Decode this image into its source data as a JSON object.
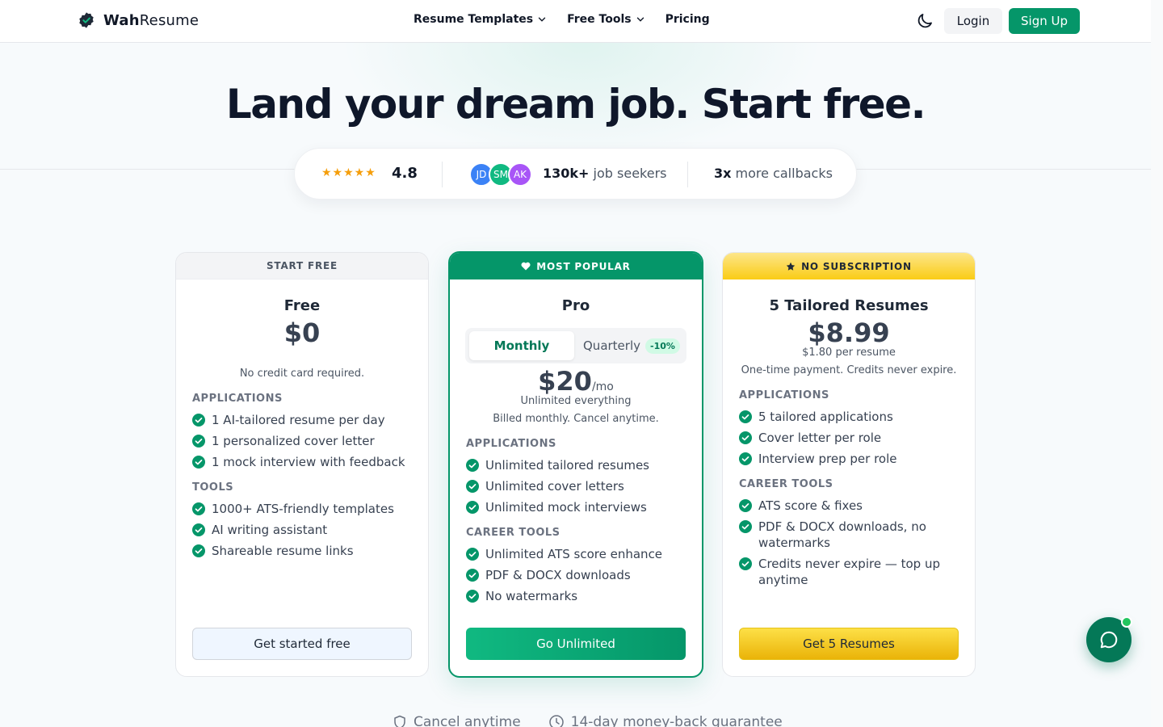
{
  "header": {
    "logo_bold": "Wah",
    "logo_rest": "Resume",
    "nav": [
      {
        "label": "Resume Templates",
        "dropdown": true
      },
      {
        "label": "Free Tools",
        "dropdown": true
      },
      {
        "label": "Pricing",
        "dropdown": false
      }
    ],
    "login_label": "Login",
    "signup_label": "Sign Up",
    "accent": "#059669"
  },
  "hero": {
    "title": "Land your dream job. Start free.",
    "stats": {
      "stars": "★★★★★",
      "rating": "4.8",
      "avatars": [
        {
          "initials": "JD",
          "color": "#3b82f6"
        },
        {
          "initials": "SM",
          "color": "#10b981"
        },
        {
          "initials": "AK",
          "color": "#a855f7"
        }
      ],
      "seekers_count": "130k+",
      "seekers_label": "job seekers",
      "callbacks_count": "3x",
      "callbacks_label": "more callbacks"
    }
  },
  "plans": {
    "free": {
      "ribbon": "START FREE",
      "name": "Free",
      "price": "$0",
      "note": "No credit card required.",
      "section1": "APPLICATIONS",
      "features1": [
        "1 AI-tailored resume per day",
        "1 personalized cover letter",
        "1 mock interview with feedback"
      ],
      "section2": "TOOLS",
      "features2": [
        "1000+ ATS-friendly templates",
        "AI writing assistant",
        "Shareable resume links"
      ],
      "cta": "Get started free"
    },
    "pro": {
      "ribbon": "MOST POPULAR",
      "name": "Pro",
      "billing_monthly": "Monthly",
      "billing_quarterly": "Quarterly",
      "discount": "-10%",
      "price": "$20",
      "per": "/mo",
      "subtitle": "Unlimited everything",
      "note": "Billed monthly. Cancel anytime.",
      "section1": "APPLICATIONS",
      "features1": [
        "Unlimited tailored resumes",
        "Unlimited cover letters",
        "Unlimited mock interviews"
      ],
      "section2": "CAREER TOOLS",
      "features2": [
        "Unlimited ATS score enhance",
        "PDF & DOCX downloads",
        "No watermarks"
      ],
      "cta": "Go Unlimited"
    },
    "tailored": {
      "ribbon": "NO SUBSCRIPTION",
      "name": "5 Tailored Resumes",
      "price": "$8.99",
      "per_resume": "$1.80 per resume",
      "note": "One-time payment. Credits never expire.",
      "section1": "APPLICATIONS",
      "features1": [
        "5 tailored applications",
        "Cover letter per role",
        "Interview prep per role"
      ],
      "section2": "CAREER TOOLS",
      "features2": [
        "ATS score & fixes",
        "PDF & DOCX downloads, no watermarks",
        "Credits never expire — top up anytime"
      ],
      "cta": "Get 5 Resumes"
    }
  },
  "guarantees": [
    "Cancel anytime",
    "14-day money-back guarantee"
  ]
}
